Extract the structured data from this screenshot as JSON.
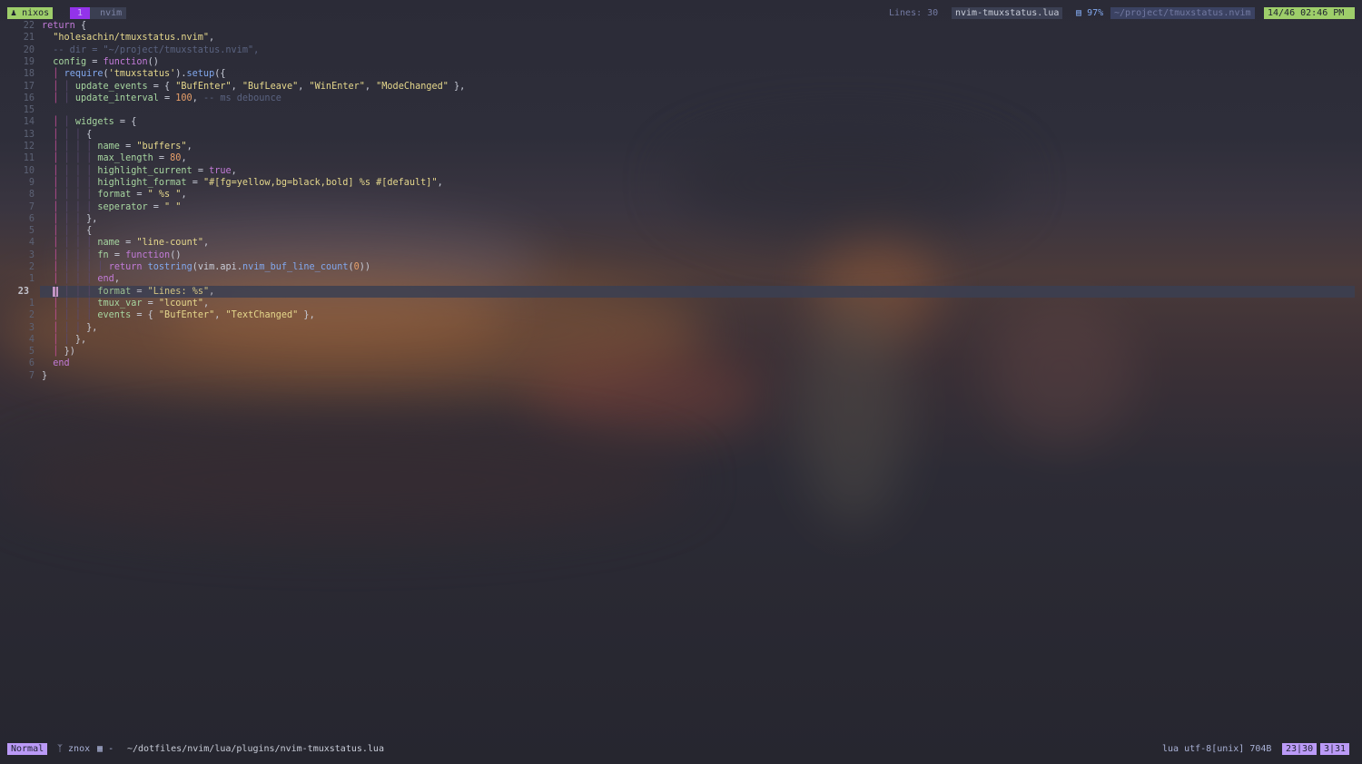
{
  "tmux": {
    "session": "nixos",
    "window_index": "1",
    "window_name": "nvim",
    "widget_lines": "Lines: 30",
    "filename": "nvim-tmuxstatus.lua",
    "battery": "97%",
    "cwd": "~/project/tmuxstatus.nvim",
    "datetime": "14/46 02:46 PM"
  },
  "editor": {
    "lines": [
      {
        "n": "22",
        "t": "return {"
      },
      {
        "n": "21",
        "t": "  \"holesachin/tmuxstatus.nvim\","
      },
      {
        "n": "20",
        "t": "  -- dir = \"~/project/tmuxstatus.nvim\","
      },
      {
        "n": "19",
        "t": "  config = function()"
      },
      {
        "n": "18",
        "t": "    require('tmuxstatus').setup({"
      },
      {
        "n": "17",
        "t": "      update_events = { \"BufEnter\", \"BufLeave\", \"WinEnter\", \"ModeChanged\" },"
      },
      {
        "n": "16",
        "t": "      update_interval = 100, -- ms debounce"
      },
      {
        "n": "15",
        "t": ""
      },
      {
        "n": "14",
        "t": "      widgets = {"
      },
      {
        "n": "13",
        "t": "        {"
      },
      {
        "n": "12",
        "t": "          name = \"buffers\","
      },
      {
        "n": "11",
        "t": "          max_length = 80,"
      },
      {
        "n": "10",
        "t": "          highlight_current = true,"
      },
      {
        "n": "9",
        "t": "          highlight_format = \"#[fg=yellow,bg=black,bold] %s #[default]\","
      },
      {
        "n": "8",
        "t": "          format = \" %s \","
      },
      {
        "n": "7",
        "t": "          seperator = \" \""
      },
      {
        "n": "6",
        "t": "        },"
      },
      {
        "n": "5",
        "t": "        {"
      },
      {
        "n": "4",
        "t": "          name = \"line-count\","
      },
      {
        "n": "3",
        "t": "          fn = function()"
      },
      {
        "n": "2",
        "t": "            return tostring(vim.api.nvim_buf_line_count(0))"
      },
      {
        "n": "1",
        "t": "          end,"
      },
      {
        "n": "23",
        "t": "          format = \"Lines: %s\",",
        "current": true
      },
      {
        "n": "1",
        "t": "          tmux_var = \"lcount\","
      },
      {
        "n": "2",
        "t": "          events = { \"BufEnter\", \"TextChanged\" },"
      },
      {
        "n": "3",
        "t": "        },"
      },
      {
        "n": "4",
        "t": "      },"
      },
      {
        "n": "5",
        "t": "    })"
      },
      {
        "n": "6",
        "t": "  end"
      },
      {
        "n": "7",
        "t": "}"
      }
    ]
  },
  "statusline": {
    "mode": "Normal",
    "branch": "znox",
    "diff": "-",
    "filepath": "~/dotfiles/nvim/lua/plugins/nvim-tmuxstatus.lua",
    "filetype": "lua",
    "encoding": "utf-8[unix]",
    "size": "704B",
    "progress": "23|30",
    "location": "3|31"
  },
  "colors": {
    "accent_green": "#9ece6a",
    "accent_purple": "#bb9af7",
    "background": "#23232f"
  }
}
